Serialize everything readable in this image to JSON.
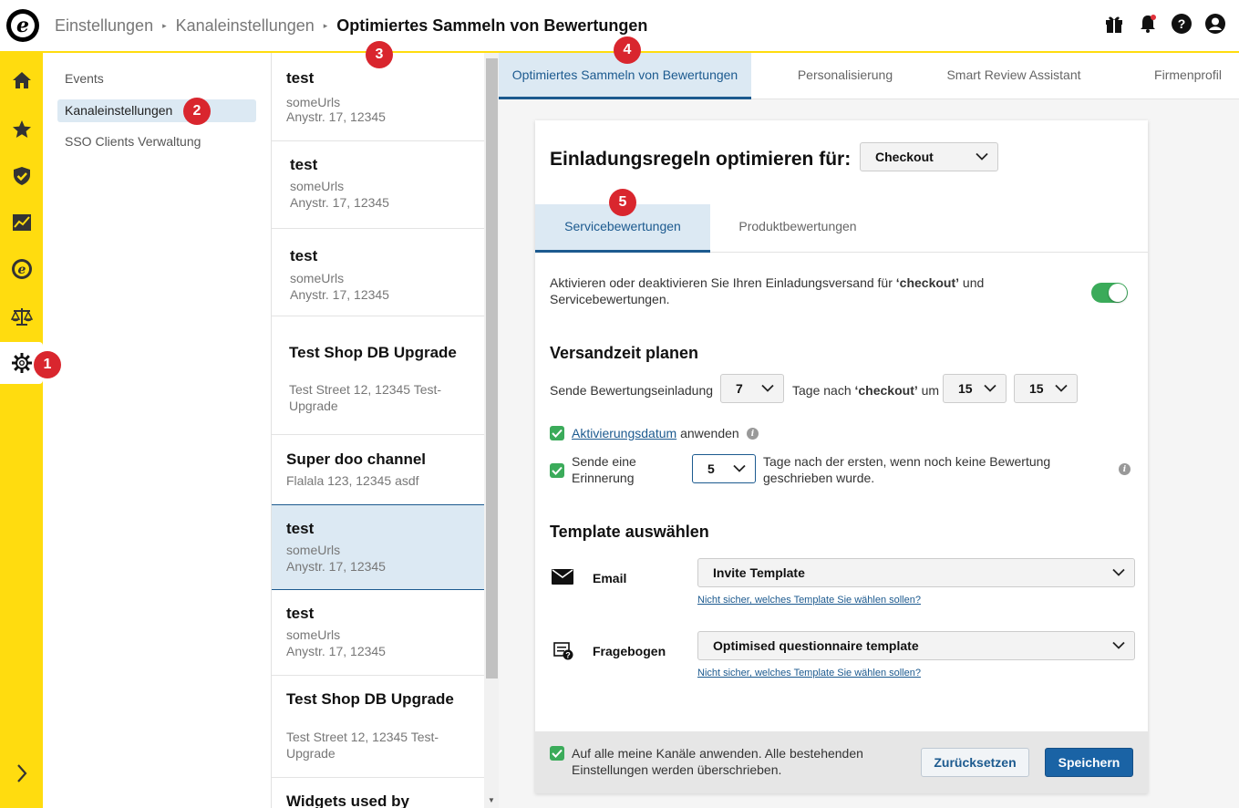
{
  "breadcrumb": {
    "items": [
      "Einstellungen",
      "Kanaleinstellungen",
      "Optimiertes Sammeln von Bewertungen"
    ]
  },
  "logo_letter": "e",
  "top_icons": [
    "gift-icon",
    "bell-icon",
    "help-icon",
    "account-icon"
  ],
  "nav_icons": [
    "home-icon",
    "star-icon",
    "shield-icon",
    "chart-icon",
    "e-icon",
    "scale-icon",
    "gear-icon"
  ],
  "subnav": {
    "items": [
      "Events",
      "Kanaleinstellungen",
      "SSO Clients Verwaltung"
    ],
    "active": "Kanaleinstellungen"
  },
  "channels": [
    {
      "name": "test",
      "line1": "someUrls",
      "line2": "Anystr. 17, 12345"
    },
    {
      "name": "test",
      "line1": "someUrls",
      "line2": "Anystr. 17, 12345"
    },
    {
      "name": "test",
      "line1": "someUrls",
      "line2": "Anystr. 17, 12345"
    },
    {
      "name": "Test Shop DB Upgrade",
      "line1": "Test Street 12, 12345 Test-",
      "line2": "Upgrade"
    },
    {
      "name": "Super doo channel",
      "line1": "Flalala 123, 12345 asdf",
      "line2": ""
    },
    {
      "name": "test",
      "line1": "someUrls",
      "line2": "Anystr. 17, 12345"
    },
    {
      "name": "test",
      "line1": "someUrls",
      "line2": "Anystr. 17, 12345"
    },
    {
      "name": "Test Shop DB Upgrade",
      "line1": "Test Street 12, 12345 Test-",
      "line2": "Upgrade"
    },
    {
      "name": "Widgets used by",
      "line1": "",
      "line2": ""
    }
  ],
  "main_tabs": [
    "Optimiertes Sammeln von Bewertungen",
    "Personalisierung",
    "Smart Review Assistant",
    "Firmenprofil"
  ],
  "card": {
    "title": "Einladungsregeln optimieren für:",
    "optimize_for": "Checkout",
    "subtabs": [
      "Servicebewertungen",
      "Produktbewertungen"
    ],
    "activate_text_1": "Aktivieren oder deaktivieren Sie Ihren Einladungsversand für ",
    "activate_text_bold": "‘checkout’",
    "activate_text_2": " und",
    "activate_text_3": "Servicebewertungen.",
    "toggle_on": true,
    "schedule_heading": "Versandzeit planen",
    "schedule_label": "Sende Bewertungseinladung",
    "days_value": "7",
    "days_after_label": "Tage nach",
    "days_after_bold": "‘checkout’",
    "um_label": "um",
    "hour_value": "15",
    "minute_value": "15",
    "activation_link": "Aktivierungsdatum",
    "activation_suffix": "anwenden",
    "reminder_label_1": "Sende eine",
    "reminder_label_2": "Erinnerung",
    "reminder_value": "5",
    "reminder_text_1": "Tage nach der ersten, wenn noch keine Bewertung",
    "reminder_text_2": "geschrieben wurde.",
    "template_heading": "Template auswählen",
    "email_label": "Email",
    "email_template": "Invite Template",
    "help_link": "Nicht sicher, welches Template Sie wählen sollen?",
    "questionnaire_label": "Fragebogen",
    "questionnaire_template": "Optimised questionnaire template",
    "apply_all_1": "Auf alle meine Kanäle anwenden. Alle bestehenden",
    "apply_all_2": "Einstellungen werden überschrieben.",
    "reset_button": "Zurücksetzen",
    "save_button": "Speichern"
  },
  "badges": [
    "1",
    "2",
    "3",
    "4",
    "5"
  ],
  "colors": {
    "brand_yellow": "#ffdc0f",
    "accent_blue": "#1c5a8f",
    "toggle_green": "#3bab5a",
    "badge_red": "#d9262e"
  }
}
